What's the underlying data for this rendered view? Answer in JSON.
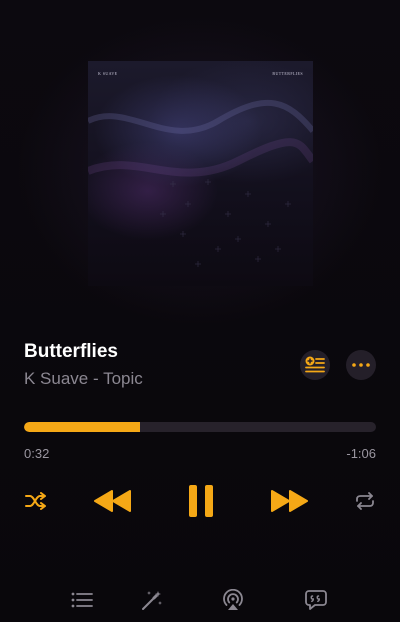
{
  "artwork": {
    "artist_text": "K SUAVE",
    "title_text": "BUTTERFLIES"
  },
  "track": {
    "title": "Butterflies",
    "artist": "K Suave - Topic"
  },
  "actions": {
    "add_to_queue_icon": "add-to-queue-icon",
    "more_icon": "more-icon"
  },
  "progress": {
    "elapsed": "0:32",
    "remaining": "-1:06",
    "fraction": 0.33
  },
  "controls": {
    "shuffle_icon": "shuffle-icon",
    "rewind_icon": "rewind-icon",
    "pause_icon": "pause-icon",
    "forward_icon": "fast-forward-icon",
    "repeat_icon": "repeat-icon"
  },
  "bottom_bar": {
    "items": [
      "queue-list-icon",
      "magic-wand-icon",
      "airplay-icon",
      "lyrics-icon"
    ]
  },
  "colors": {
    "accent": "#f5a816",
    "background": "#0b080d",
    "secondary_text": "#8b8791",
    "button_bg": "#241f29"
  }
}
